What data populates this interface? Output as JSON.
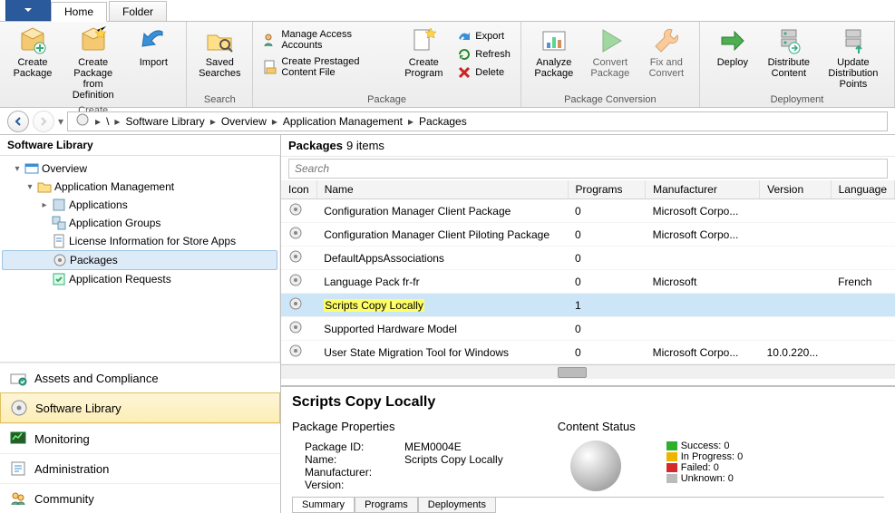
{
  "tabs": {
    "app_menu": "",
    "home": "Home",
    "folder": "Folder"
  },
  "ribbon": {
    "create": {
      "group_label": "Create",
      "create_package": "Create\nPackage",
      "create_from_def": "Create Package\nfrom Definition",
      "import": "Import"
    },
    "search": {
      "group_label": "Search",
      "saved_searches": "Saved\nSearches"
    },
    "package": {
      "group_label": "Package",
      "manage_access": "Manage Access Accounts",
      "create_prestaged": "Create Prestaged Content File",
      "create_program": "Create\nProgram",
      "export": "Export",
      "refresh": "Refresh",
      "delete": "Delete"
    },
    "conversion": {
      "group_label": "Package Conversion",
      "analyze": "Analyze\nPackage",
      "convert": "Convert\nPackage",
      "fix_convert": "Fix and\nConvert"
    },
    "deployment": {
      "group_label": "Deployment",
      "deploy": "Deploy",
      "distribute": "Distribute\nContent",
      "update_dp": "Update\nDistribution Points"
    }
  },
  "breadcrumb": {
    "items": [
      "Software Library",
      "Overview",
      "Application Management",
      "Packages"
    ]
  },
  "side": {
    "title": "Software Library",
    "tree": {
      "overview": "Overview",
      "app_mgmt": "Application Management",
      "applications": "Applications",
      "app_groups": "Application Groups",
      "license_info": "License Information for Store Apps",
      "packages": "Packages",
      "app_requests": "Application Requests"
    },
    "navpanes": {
      "assets": "Assets and Compliance",
      "software": "Software Library",
      "monitoring": "Monitoring",
      "admin": "Administration",
      "community": "Community"
    }
  },
  "list": {
    "title": "Packages",
    "count_label": "9 items",
    "search_placeholder": "Search",
    "columns": {
      "icon": "Icon",
      "name": "Name",
      "programs": "Programs",
      "manufacturer": "Manufacturer",
      "version": "Version",
      "language": "Language"
    },
    "rows": [
      {
        "name": "Configuration Manager Client Package",
        "programs": "0",
        "manufacturer": "Microsoft Corpo...",
        "version": "",
        "language": ""
      },
      {
        "name": "Configuration Manager Client Piloting Package",
        "programs": "0",
        "manufacturer": "Microsoft Corpo...",
        "version": "",
        "language": ""
      },
      {
        "name": "DefaultAppsAssociations",
        "programs": "0",
        "manufacturer": "",
        "version": "",
        "language": ""
      },
      {
        "name": "Language Pack fr-fr",
        "programs": "0",
        "manufacturer": "Microsoft",
        "version": "",
        "language": "French"
      },
      {
        "name": "Scripts Copy Locally",
        "programs": "1",
        "manufacturer": "",
        "version": "",
        "language": ""
      },
      {
        "name": "Supported Hardware Model",
        "programs": "0",
        "manufacturer": "",
        "version": "",
        "language": ""
      },
      {
        "name": "User State Migration Tool for Windows",
        "programs": "0",
        "manufacturer": "Microsoft Corpo...",
        "version": "10.0.220...",
        "language": ""
      }
    ],
    "selected_index": 4
  },
  "detail": {
    "title": "Scripts Copy Locally",
    "pkg_props_label": "Package Properties",
    "content_status_label": "Content Status",
    "props": {
      "package_id_k": "Package ID:",
      "package_id_v": "MEM0004E",
      "name_k": "Name:",
      "name_v": "Scripts Copy Locally",
      "manufacturer_k": "Manufacturer:",
      "manufacturer_v": "",
      "version_k": "Version:",
      "version_v": ""
    },
    "status": {
      "success": "Success: 0",
      "in_progress": "In Progress: 0",
      "failed": "Failed: 0",
      "unknown": "Unknown: 0"
    },
    "tabs": {
      "summary": "Summary",
      "programs": "Programs",
      "deployments": "Deployments"
    }
  }
}
